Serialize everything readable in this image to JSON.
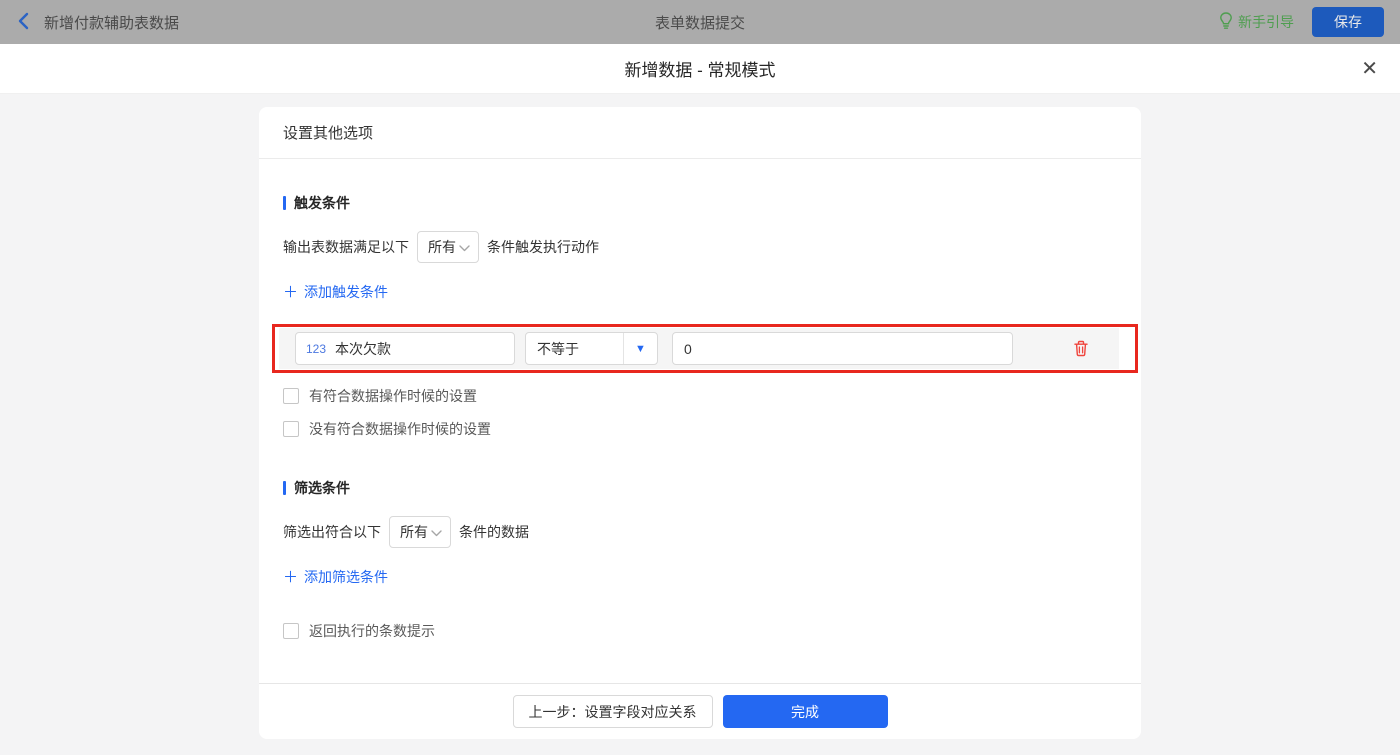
{
  "topbar": {
    "back_label": "新增付款辅助表数据",
    "title": "表单数据提交",
    "guide_label": "新手引导",
    "save_label": "保存"
  },
  "modal": {
    "title": "新增数据 - 常规模式",
    "close_glyph": "✕"
  },
  "card": {
    "header": "设置其他选项"
  },
  "trigger": {
    "title": "触发条件",
    "prefix": "输出表数据满足以下",
    "match_value": "所有",
    "suffix": "条件触发执行动作",
    "add_label": "添加触发条件",
    "condition": {
      "field_type_tag": "123",
      "field_name": "本次欠款",
      "operator": "不等于",
      "value": "0"
    },
    "checkboxes": [
      {
        "label": "有符合数据操作时候的设置",
        "checked": false
      },
      {
        "label": "没有符合数据操作时候的设置",
        "checked": false
      }
    ]
  },
  "filter": {
    "title": "筛选条件",
    "prefix": "筛选出符合以下",
    "match_value": "所有",
    "suffix": "条件的数据",
    "add_label": "添加筛选条件",
    "checkboxes": [
      {
        "label": "返回执行的条数提示",
        "checked": false
      }
    ]
  },
  "footer": {
    "prev_label": "上一步：设置字段对应关系",
    "done_label": "完成"
  },
  "icons": {
    "plus": "＋",
    "caret_down": "▼"
  },
  "colors": {
    "accent_blue": "#2468f2",
    "highlight_red": "#e8271e",
    "danger_red": "#f0443c",
    "guide_green": "#4f9e50",
    "topbar_dim_gray": "#ababab"
  }
}
